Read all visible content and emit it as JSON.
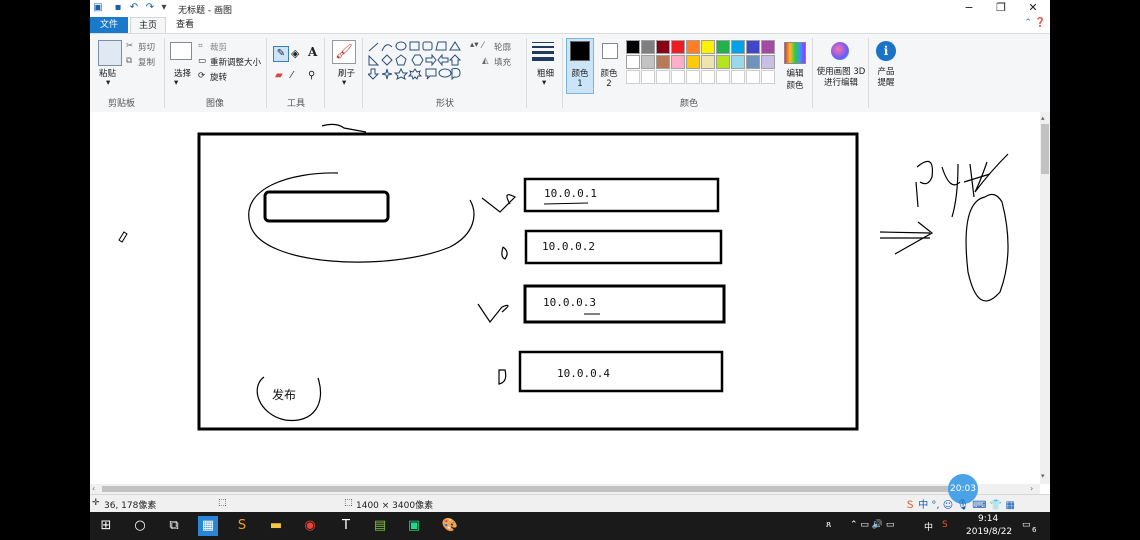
{
  "window": {
    "title": "无标题 - 画图",
    "controls": {
      "minimize": "−",
      "maximize": "❐",
      "close": "✕"
    }
  },
  "tabs": [
    {
      "label": "文件"
    },
    {
      "label": "主页"
    },
    {
      "label": "查看"
    }
  ],
  "ribbon": {
    "clipboard": {
      "paste": "粘贴",
      "cut": "剪切",
      "copy": "复制",
      "group": "剪贴板"
    },
    "image": {
      "select": "选择",
      "crop": "裁剪",
      "resize": "重新调整大小",
      "rotate": "旋转",
      "group": "图像"
    },
    "tools": {
      "group": "工具"
    },
    "brushes": {
      "label": "刷子"
    },
    "shapes": {
      "outline": "轮廓",
      "fill": "填充",
      "group": "形状"
    },
    "size": {
      "label": "粗细"
    },
    "colors": {
      "color1": "颜色 1",
      "color2": "颜色 2",
      "edit": "编辑颜色",
      "group": "颜色",
      "color1_value": "#000000",
      "color2_value": "#ffffff",
      "palette_row1": [
        "#000000",
        "#7f7f7f",
        "#880015",
        "#ed1c24",
        "#ff7f27",
        "#fff200",
        "#22b14c",
        "#00a2e8",
        "#3f48cc",
        "#a349a4"
      ],
      "palette_row2": [
        "#ffffff",
        "#c3c3c3",
        "#b97a57",
        "#ffaec9",
        "#ffc90e",
        "#efe4b0",
        "#b5e61d",
        "#99d9ea",
        "#7092be",
        "#c8bfe7"
      ]
    },
    "paint3d": {
      "label": "使用画图 3D 进行编辑"
    },
    "product": {
      "label": "产品提醒"
    }
  },
  "canvas": {
    "ips": [
      "10.0.0.1",
      "10.0.0.2",
      "10.0.0.3",
      "10.0.0.4"
    ],
    "publish": "发布",
    "handwriting": "Pyth"
  },
  "status": {
    "cursor_pos": "36, 178像素",
    "canvas_size": "1400 × 3400像素"
  },
  "badge": {
    "time": "20:03"
  },
  "taskbar": {
    "clock_time": "9:14",
    "clock_date": "2019/8/22",
    "ime": "中",
    "notify_count": "6"
  }
}
